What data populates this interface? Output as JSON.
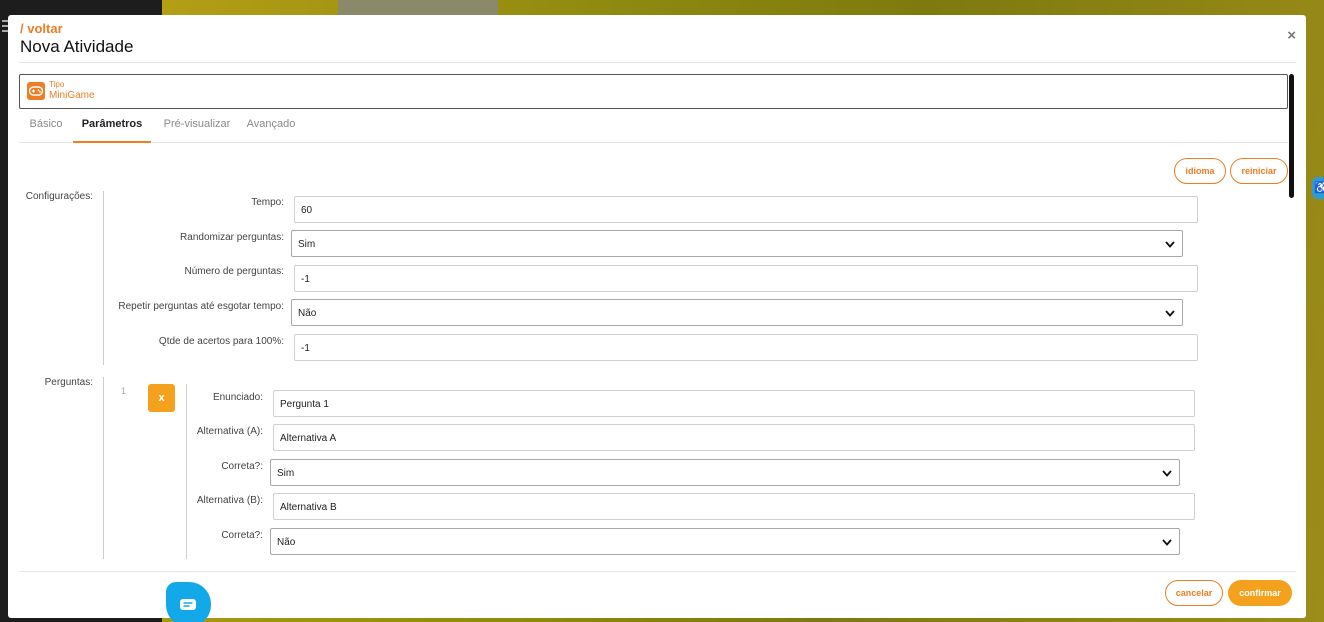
{
  "modal": {
    "back_label": "/ voltar",
    "title": "Nova Atividade",
    "close_label": "×"
  },
  "type_box": {
    "label": "Tipo",
    "value": "MiniGame",
    "icon": "gamepad-icon"
  },
  "tabs": [
    {
      "label": "Básico",
      "active": false
    },
    {
      "label": "Parâmetros",
      "active": true
    },
    {
      "label": "Pré-visualizar",
      "active": false
    },
    {
      "label": "Avançado",
      "active": false
    }
  ],
  "actions": {
    "language_label": "idioma",
    "reset_label": "reiniciar",
    "cancel_label": "cancelar",
    "confirm_label": "confirmar"
  },
  "config": {
    "section_label": "Configurações:",
    "fields": [
      {
        "label": "Tempo:",
        "value": "60",
        "type": "input"
      },
      {
        "label": "Randomizar perguntas:",
        "value": "Sim",
        "type": "select"
      },
      {
        "label": "Número de perguntas:",
        "value": "-1",
        "type": "input"
      },
      {
        "label": "Repetir perguntas até esgotar tempo:",
        "value": "Não",
        "type": "select"
      },
      {
        "label": "Qtde de acertos para 100%:",
        "value": "-1",
        "type": "input"
      }
    ]
  },
  "questions": {
    "section_label": "Perguntas:",
    "items": [
      {
        "index": "1",
        "remove_label": "x",
        "fields": [
          {
            "label": "Enunciado:",
            "value": "Pergunta 1",
            "type": "input"
          },
          {
            "label": "Alternativa (A):",
            "value": "Alternativa A",
            "type": "input"
          },
          {
            "label": "Correta?:",
            "value": "Sim",
            "type": "select"
          },
          {
            "label": "Alternativa (B):",
            "value": "Alternativa B",
            "type": "input"
          },
          {
            "label": "Correta?:",
            "value": "Não",
            "type": "select"
          }
        ]
      }
    ]
  },
  "colors": {
    "accent": "#ee7d25",
    "button": "#f4a21e",
    "chat": "#13a8e8"
  }
}
